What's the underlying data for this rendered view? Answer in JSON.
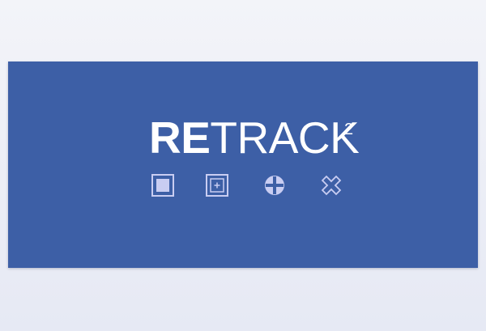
{
  "title": {
    "bold_part": "RE",
    "regular_part": "TRACK",
    "superscript": "2"
  },
  "icons": [
    {
      "name": "filled-square-icon"
    },
    {
      "name": "square-plus-icon"
    },
    {
      "name": "crosshair-circle-icon"
    },
    {
      "name": "cross-x-icon"
    }
  ],
  "colors": {
    "banner": "#3d5fa6",
    "icon": "#c9cdf2",
    "text": "#ffffff",
    "background": "#eef0f7"
  }
}
